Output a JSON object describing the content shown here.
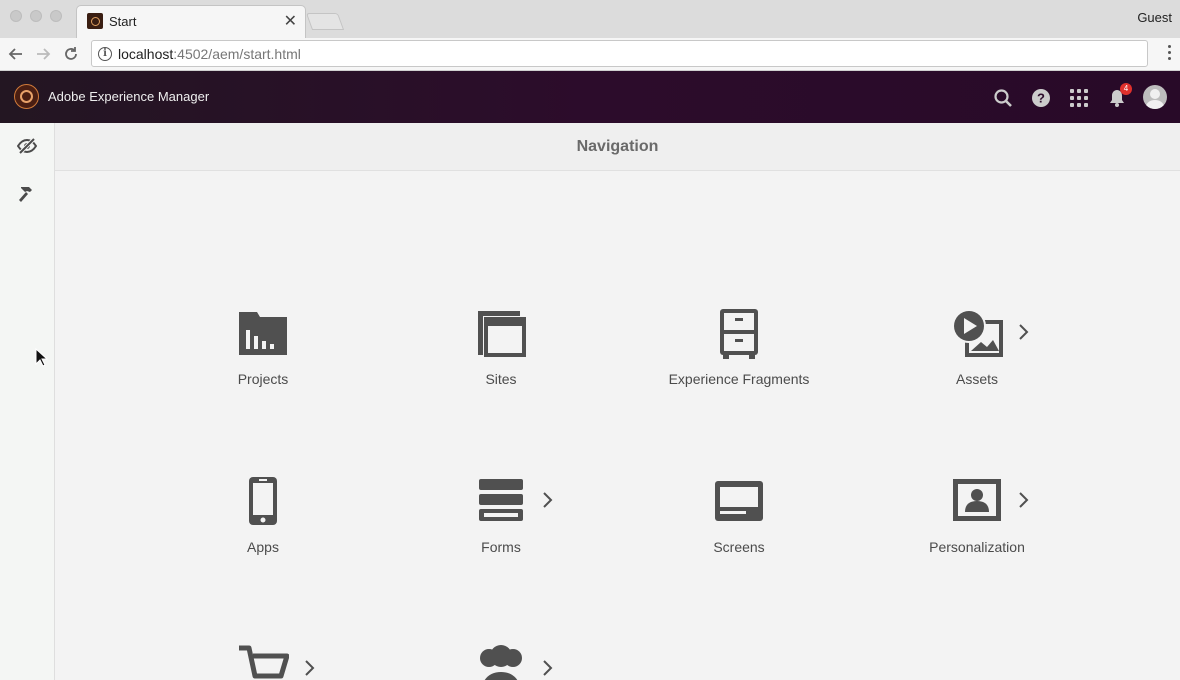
{
  "browser": {
    "tab_title": "Start",
    "guest_label": "Guest",
    "url_host": "localhost",
    "url_rest": ":4502/aem/start.html"
  },
  "header": {
    "app_title": "Adobe Experience Manager",
    "notification_count": "4",
    "icons": [
      "search-icon",
      "help-icon",
      "solutions-grid-icon",
      "bell-icon",
      "user-avatar"
    ]
  },
  "rail": {
    "items": [
      "navigation-eye-icon",
      "tools-hammer-icon"
    ]
  },
  "page": {
    "title": "Navigation"
  },
  "tiles": [
    {
      "label": "Projects",
      "icon": "projects-icon",
      "has_children": false
    },
    {
      "label": "Sites",
      "icon": "sites-icon",
      "has_children": false
    },
    {
      "label": "Experience Fragments",
      "icon": "experience-fragments-icon",
      "has_children": false
    },
    {
      "label": "Assets",
      "icon": "assets-icon",
      "has_children": true
    },
    {
      "label": "Apps",
      "icon": "apps-icon",
      "has_children": false
    },
    {
      "label": "Forms",
      "icon": "forms-icon",
      "has_children": true
    },
    {
      "label": "Screens",
      "icon": "screens-icon",
      "has_children": false
    },
    {
      "label": "Personalization",
      "icon": "personalization-icon",
      "has_children": true
    },
    {
      "label": "",
      "icon": "commerce-cart-icon",
      "has_children": true
    },
    {
      "label": "",
      "icon": "communities-icon",
      "has_children": true
    }
  ],
  "colors": {
    "header_bg": "#2c0c2b",
    "content_bg": "#f3f3f3",
    "icon": "#505050",
    "badge": "#e0302c"
  }
}
